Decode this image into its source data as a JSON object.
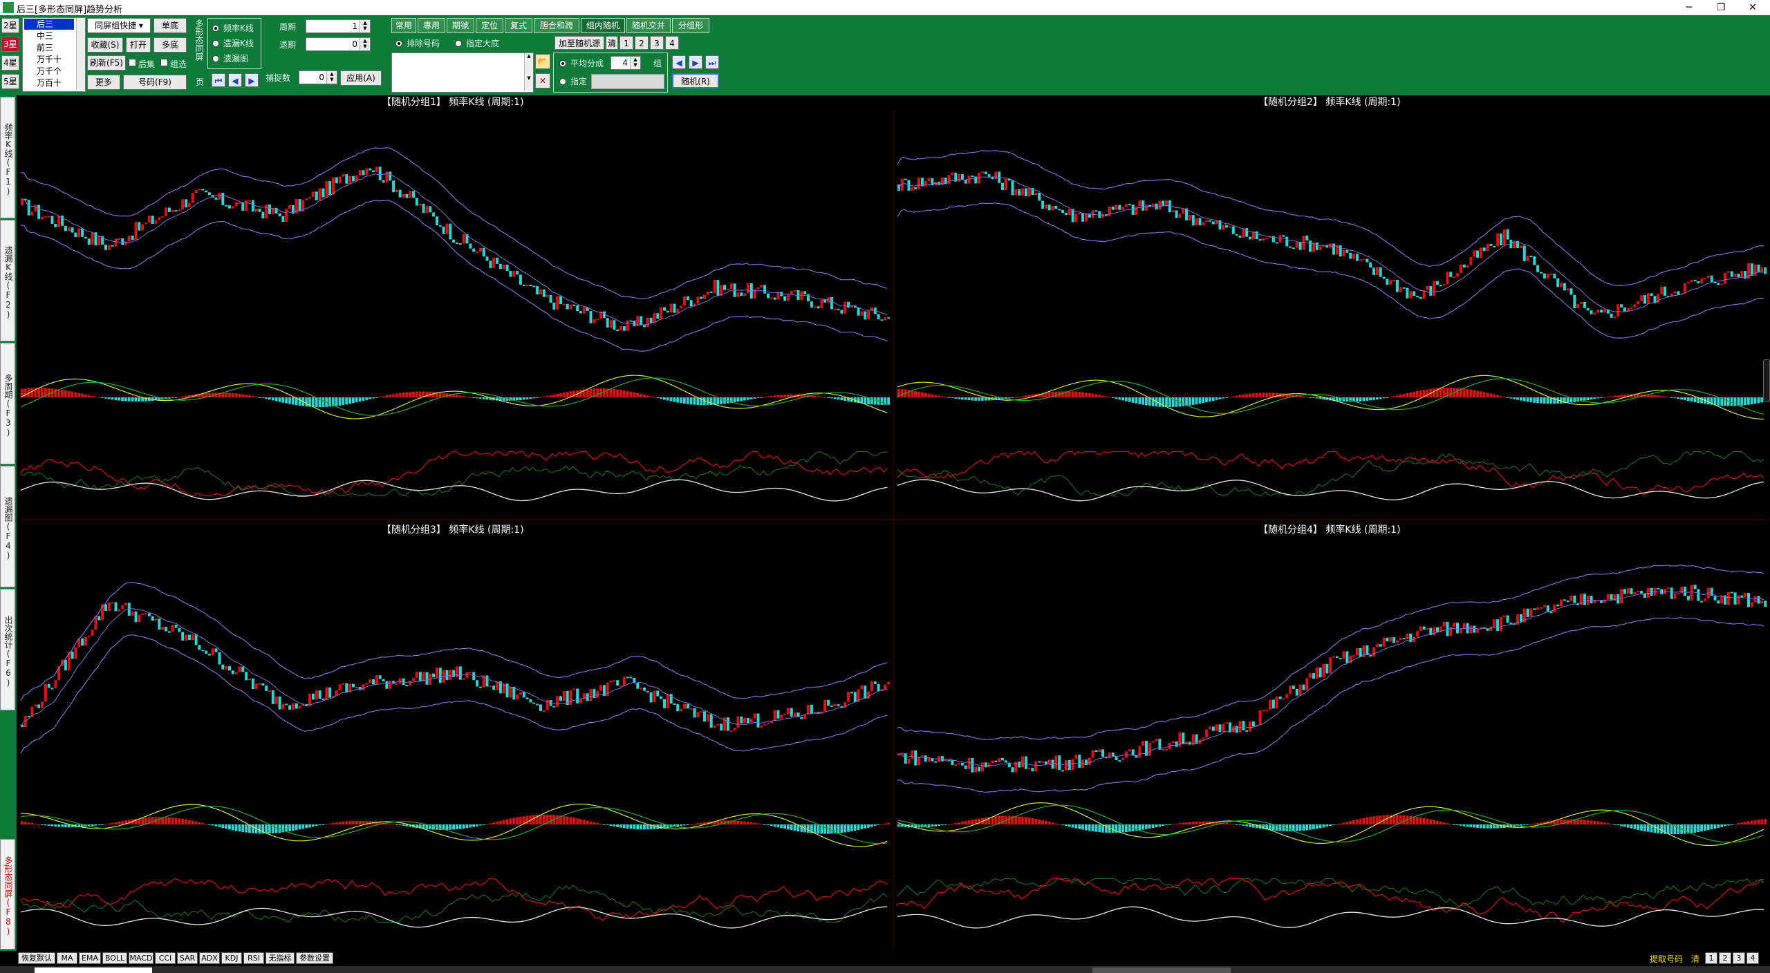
{
  "window": {
    "title": "后三[多形态同屏]趋势分析",
    "minimize": "─",
    "maximize": "❐",
    "close": "✕"
  },
  "star_buttons": [
    "2星",
    "3星",
    "4星",
    "5星"
  ],
  "position_list": [
    "后三",
    "中三",
    "前三",
    "万千十",
    "万千个",
    "万百十"
  ],
  "toolbar": {
    "quick_select": "同屏组快捷 ▾",
    "single": "单底",
    "favorite": "收藏(S)",
    "open": "打开",
    "multi": "多底",
    "refresh": "刷新(F5)",
    "follow": "后集",
    "group_select": "组选",
    "more": "更多",
    "code": "号码(F9)",
    "multi_form_label": "多形态同屏",
    "page_label": "页",
    "radio_freq_k": "频率K线",
    "radio_miss_k": "遗漏K线",
    "radio_miss_chart": "遗漏图",
    "period_label": "周期",
    "period_value": "1",
    "back_label": "退期",
    "back_value": "0",
    "filter_label": "捕捉数",
    "filter_value": "0",
    "apply": "应用(A)"
  },
  "tabs": [
    "常用",
    "專用",
    "期號",
    "定位",
    "复式",
    "胆合和跨",
    "组内随机",
    "随机交并",
    "分组形"
  ],
  "active_tab": "组内随机",
  "random_panel": {
    "exclude_label": "排除号码",
    "specify_label": "指定大底",
    "add_random": "加至随机源",
    "clear": "清",
    "group_nums": [
      "1",
      "2",
      "3",
      "4"
    ],
    "avg_label": "平均分成",
    "avg_value": "4",
    "avg_unit": "组",
    "specify2_label": "指定",
    "random_button": "随机(R)"
  },
  "side_tabs": [
    "频率K线(F1)",
    "遗漏K线(F2)",
    "多周期(F3)",
    "遗漏图(F4)",
    "出次统计(F6)",
    "多形态同屏(F8)"
  ],
  "panes": [
    {
      "title": "【随机分组1】 频率K线 (周期:1)"
    },
    {
      "title": "【随机分组2】 频率K线 (周期:1)"
    },
    {
      "title": "【随机分组3】 频率K线 (周期:1)"
    },
    {
      "title": "【随机分组4】 频率K线 (周期:1)"
    }
  ],
  "bottom_buttons": [
    "恢复默认",
    "MA",
    "EMA",
    "BOLL",
    "MACD",
    "CCI",
    "SAR",
    "ADX",
    "KDJ",
    "RSI",
    "无指标",
    "参数设置"
  ],
  "bottom_right": {
    "label": "提取号码",
    "clear": "清",
    "nums": [
      "1",
      "2",
      "3",
      "4"
    ]
  },
  "colors": {
    "toolbar_green": "#0f7a3a",
    "up": "#e01010",
    "down": "#28d6d6",
    "band": "#7b6fd6",
    "macd_fast": "#ccee33",
    "macd_slow": "#22aa22",
    "kdj_red": "#cc1111",
    "kdj_green": "#1e7a1e",
    "kdj_white": "#e8e8e8"
  }
}
